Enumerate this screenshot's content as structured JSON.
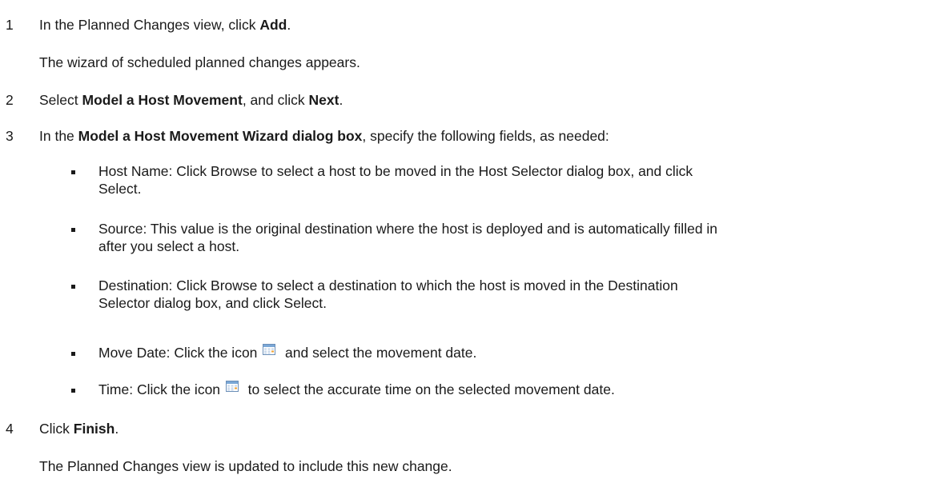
{
  "steps": [
    {
      "number": "1",
      "pre": "In the Planned Changes view, click ",
      "bold": "Add",
      "post": ".",
      "note": "The wizard of scheduled planned changes appears."
    },
    {
      "number": "2",
      "pre": "Select ",
      "bold": "Model a Host Movement",
      "mid": ", and click ",
      "bold2": "Next",
      "post": "."
    },
    {
      "number": "3",
      "pre": "In the ",
      "bold": "Model a Host Movement Wizard dialog box",
      "post": ", specify the following fields, as needed:",
      "bullets": [
        {
          "line1": "Host Name: Click Browse to select a host to be moved in the Host Selector dialog box, and click",
          "line2": "Select."
        },
        {
          "line1": "Source: This value is the original destination where the host is deployed and is automatically filled in",
          "line2": "after you select a host."
        },
        {
          "line1": "Destination: Click Browse to select a destination to which the host is moved in the Destination",
          "line2": "Selector dialog box, and click Select."
        },
        {
          "pre": "Move Date: Click the icon",
          "icon": "calendar-icon",
          "post": "and select the movement date."
        },
        {
          "pre": "Time: Click the icon",
          "icon": "calendar-icon",
          "post": "to select the accurate time on the selected movement date."
        }
      ]
    },
    {
      "number": "4",
      "pre": "Click ",
      "bold": "Finish",
      "post": ".",
      "note": "The Planned Changes view is updated to include this new change."
    }
  ]
}
